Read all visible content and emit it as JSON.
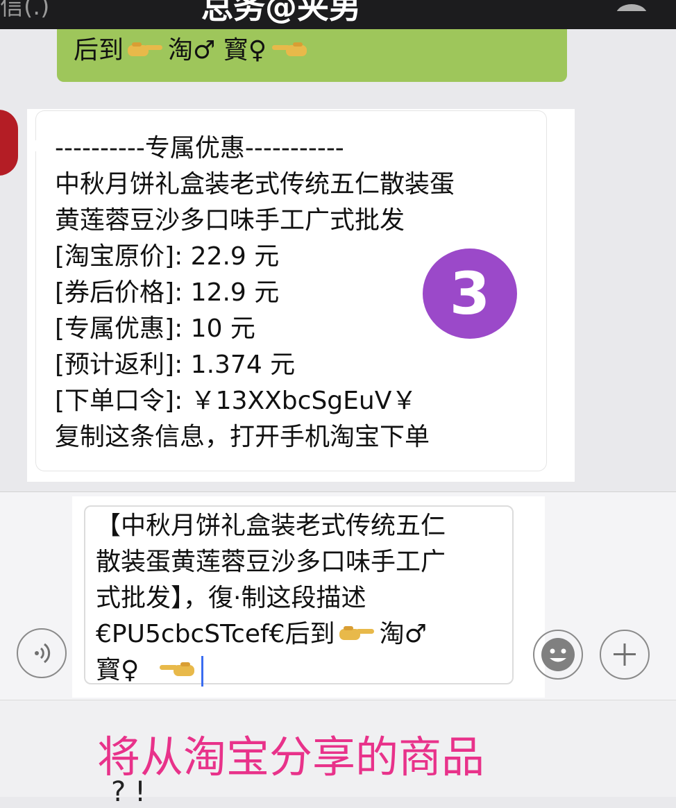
{
  "topbar": {
    "back_text": "信(.)",
    "title": "总务@夹男"
  },
  "green_bubble": {
    "part1": "后到",
    "part2": "淘♂ 寳♀"
  },
  "coupon_card": {
    "header": "----------专属优惠-----------",
    "product_line1": "中秋月饼礼盒装老式传统五仁散装蛋",
    "product_line2": "黄莲蓉豆沙多口味手工广式批发",
    "original_price": "[淘宝原价]: 22.9 元",
    "coupon_price": "[券后价格]: 12.9 元",
    "discount": "[专属优惠]: 10 元",
    "rebate": "[预计返利]: 1.374 元",
    "order_code": "[下单口令]: ￥13XXbcSgEuV￥",
    "instruction": "复制这条信息，打开手机淘宝下单"
  },
  "step_badge": "3",
  "input": {
    "line1": "【中秋月饼礼盒装老式传统五仁",
    "line2": "散装蛋黄莲蓉豆沙多口味手工广",
    "line3": "式批发】，復·制这段描述",
    "line4_a": "€PU5cbcSTcef€后到",
    "line4_b": "淘♂",
    "line5": "寳♀"
  },
  "caption": {
    "text": "将从淘宝分享的商品",
    "text2": "?   !"
  },
  "colors": {
    "green_bubble": "#9ec65b",
    "badge": "#9b49c9",
    "caption": "#e8328a",
    "cursor": "#3a6cf0"
  },
  "icons": [
    "pointing-hand-right-icon",
    "pointing-hand-left-icon",
    "voice-icon",
    "emoji-icon",
    "plus-icon",
    "profile-icon"
  ]
}
